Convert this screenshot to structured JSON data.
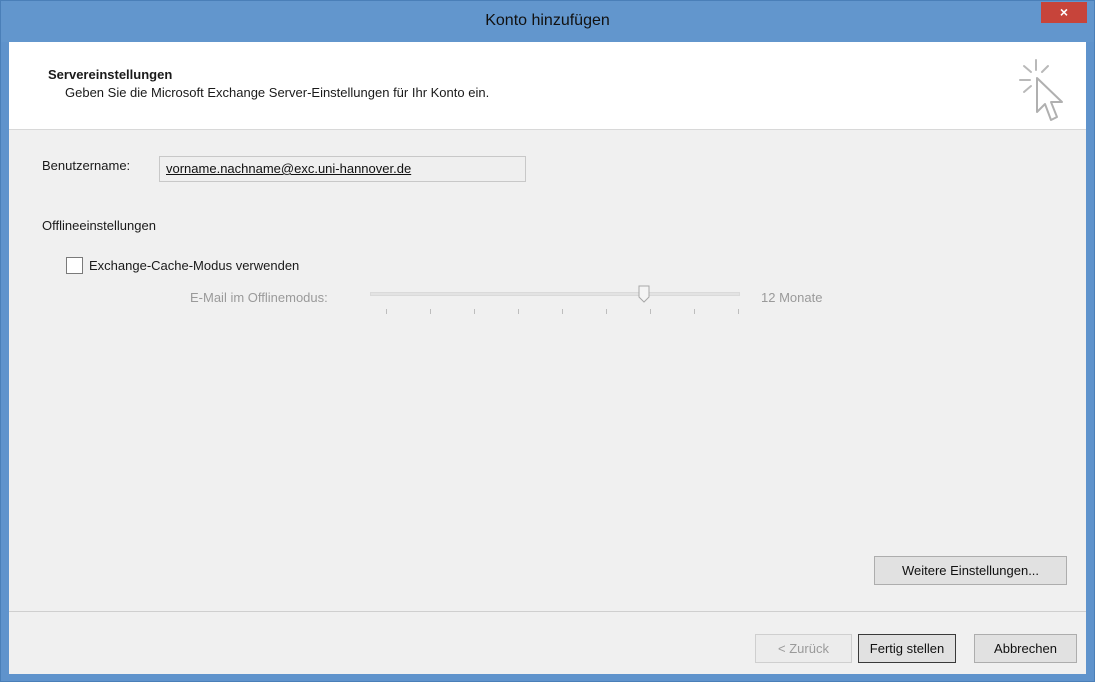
{
  "window": {
    "title": "Konto hinzufügen",
    "close_label": "×"
  },
  "header": {
    "title": "Servereinstellungen",
    "subtitle": "Geben Sie die Microsoft Exchange Server-Einstellungen für Ihr Konto ein."
  },
  "form": {
    "username_label": "Benutzername:",
    "username_value": "vorname.nachname@exc.uni-hannover.de",
    "offline_section_title": "Offlineeinstellungen",
    "cache_mode_label": "Exchange-Cache-Modus verwenden",
    "cache_mode_checked": false,
    "offline_mail_label": "E-Mail im Offlinemodus:",
    "offline_slider_value": "12 Monate",
    "offline_slider_fraction": 0.74
  },
  "buttons": {
    "more_settings": "Weitere Einstellungen...",
    "back": "< Zurück",
    "finish": "Fertig stellen",
    "cancel": "Abbrechen"
  },
  "colors": {
    "titlebar": "#6296cd",
    "close": "#c7443a",
    "client": "#f0f0f0"
  }
}
